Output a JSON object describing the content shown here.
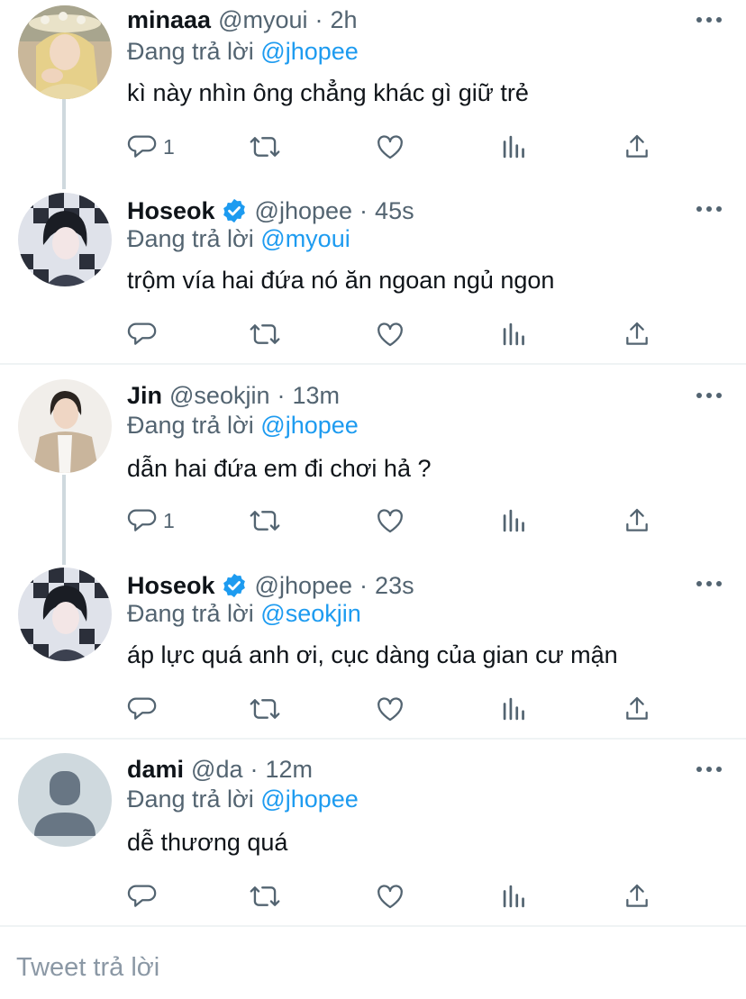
{
  "tweets": [
    {
      "name": "minaaa",
      "verified": false,
      "handle": "@myoui",
      "time": "2h",
      "reply_prefix": "Đang trả lời",
      "reply_to": "@jhopee",
      "text": "kì này nhìn ông chẳng khác gì giữ trẻ",
      "reply_count": "1",
      "avatar": "photo-blonde-woman-flower-crown"
    },
    {
      "name": "Hoseok",
      "verified": true,
      "handle": "@jhopee",
      "time": "45s",
      "reply_prefix": "Đang trả lời",
      "reply_to": "@myoui",
      "text": "trộm vía hai đứa nó ăn ngoan ngủ ngon",
      "reply_count": "",
      "avatar": "illustration-dark-hair-checkered"
    },
    {
      "name": "Jin",
      "verified": false,
      "handle": "@seokjin",
      "time": "13m",
      "reply_prefix": "Đang trả lời",
      "reply_to": "@jhopee",
      "text": "dẫn hai đứa em đi chơi hả ?",
      "reply_count": "1",
      "avatar": "photo-man-beige-jacket"
    },
    {
      "name": "Hoseok",
      "verified": true,
      "handle": "@jhopee",
      "time": "23s",
      "reply_prefix": "Đang trả lời",
      "reply_to": "@seokjin",
      "text": "áp lực quá anh ơi, cục dàng của gian cư mận",
      "reply_count": "",
      "avatar": "illustration-dark-hair-checkered"
    },
    {
      "name": "dami",
      "verified": false,
      "handle": "@da",
      "time": "12m",
      "reply_prefix": "Đang trả lời",
      "reply_to": "@jhopee",
      "text": "dễ thương quá",
      "reply_count": "",
      "avatar": "default-profile-icon"
    }
  ],
  "compose": {
    "placeholder": "Tweet trả lời"
  },
  "colors": {
    "accent": "#1d9bf0",
    "secondary": "#536471",
    "divider": "#eff3f4",
    "thread": "#cfd9de"
  },
  "icons": [
    "reply-icon",
    "retweet-icon",
    "like-icon",
    "views-icon",
    "share-icon",
    "more-icon",
    "verified-badge-icon"
  ]
}
